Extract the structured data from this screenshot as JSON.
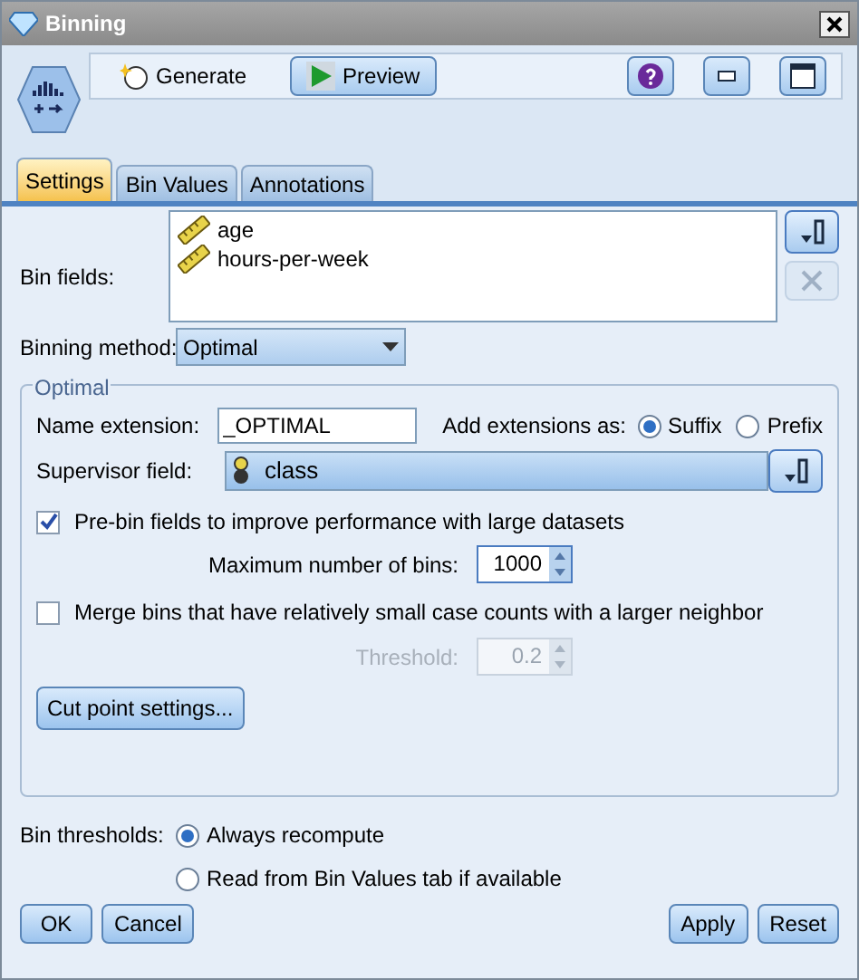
{
  "window": {
    "title": "Binning"
  },
  "toolbar": {
    "buttons": [
      {
        "label": "Generate",
        "kind": "generate"
      },
      {
        "label": "Preview",
        "kind": "preview"
      }
    ]
  },
  "tabs": [
    {
      "label": "Settings",
      "selected": true
    },
    {
      "label": "Bin Values",
      "selected": false
    },
    {
      "label": "Annotations",
      "selected": false
    }
  ],
  "bin_fields": {
    "label": "Bin fields:",
    "items": [
      "age",
      "hours-per-week"
    ]
  },
  "binning_method": {
    "label": "Binning method:",
    "value": "Optimal"
  },
  "optimal": {
    "title": "Optimal",
    "name_extension": {
      "label": "Name extension:",
      "value": "_OPTIMAL"
    },
    "add_extensions": {
      "label": "Add extensions as:",
      "options": [
        {
          "label": "Suffix",
          "selected": true
        },
        {
          "label": "Prefix",
          "selected": false
        }
      ]
    },
    "supervisor_field": {
      "label": "Supervisor field:",
      "value": "class"
    },
    "prebin": {
      "label": "Pre-bin fields to improve performance with large datasets",
      "checked": true
    },
    "max_bins": {
      "label": "Maximum number of bins:",
      "value": "1000",
      "disabled": false
    },
    "merge": {
      "label": "Merge bins that have relatively small case counts with a larger neighbor",
      "checked": false
    },
    "threshold": {
      "label": "Threshold:",
      "value": "0.2",
      "disabled": true
    },
    "cut_point_button": "Cut point settings..."
  },
  "bin_thresholds": {
    "label": "Bin thresholds:",
    "options": [
      {
        "label": "Always recompute",
        "selected": true
      },
      {
        "label": "Read from Bin Values tab if available",
        "selected": false
      }
    ]
  },
  "footer": {
    "left": [
      "OK",
      "Cancel"
    ],
    "right": [
      "Apply",
      "Reset"
    ]
  }
}
